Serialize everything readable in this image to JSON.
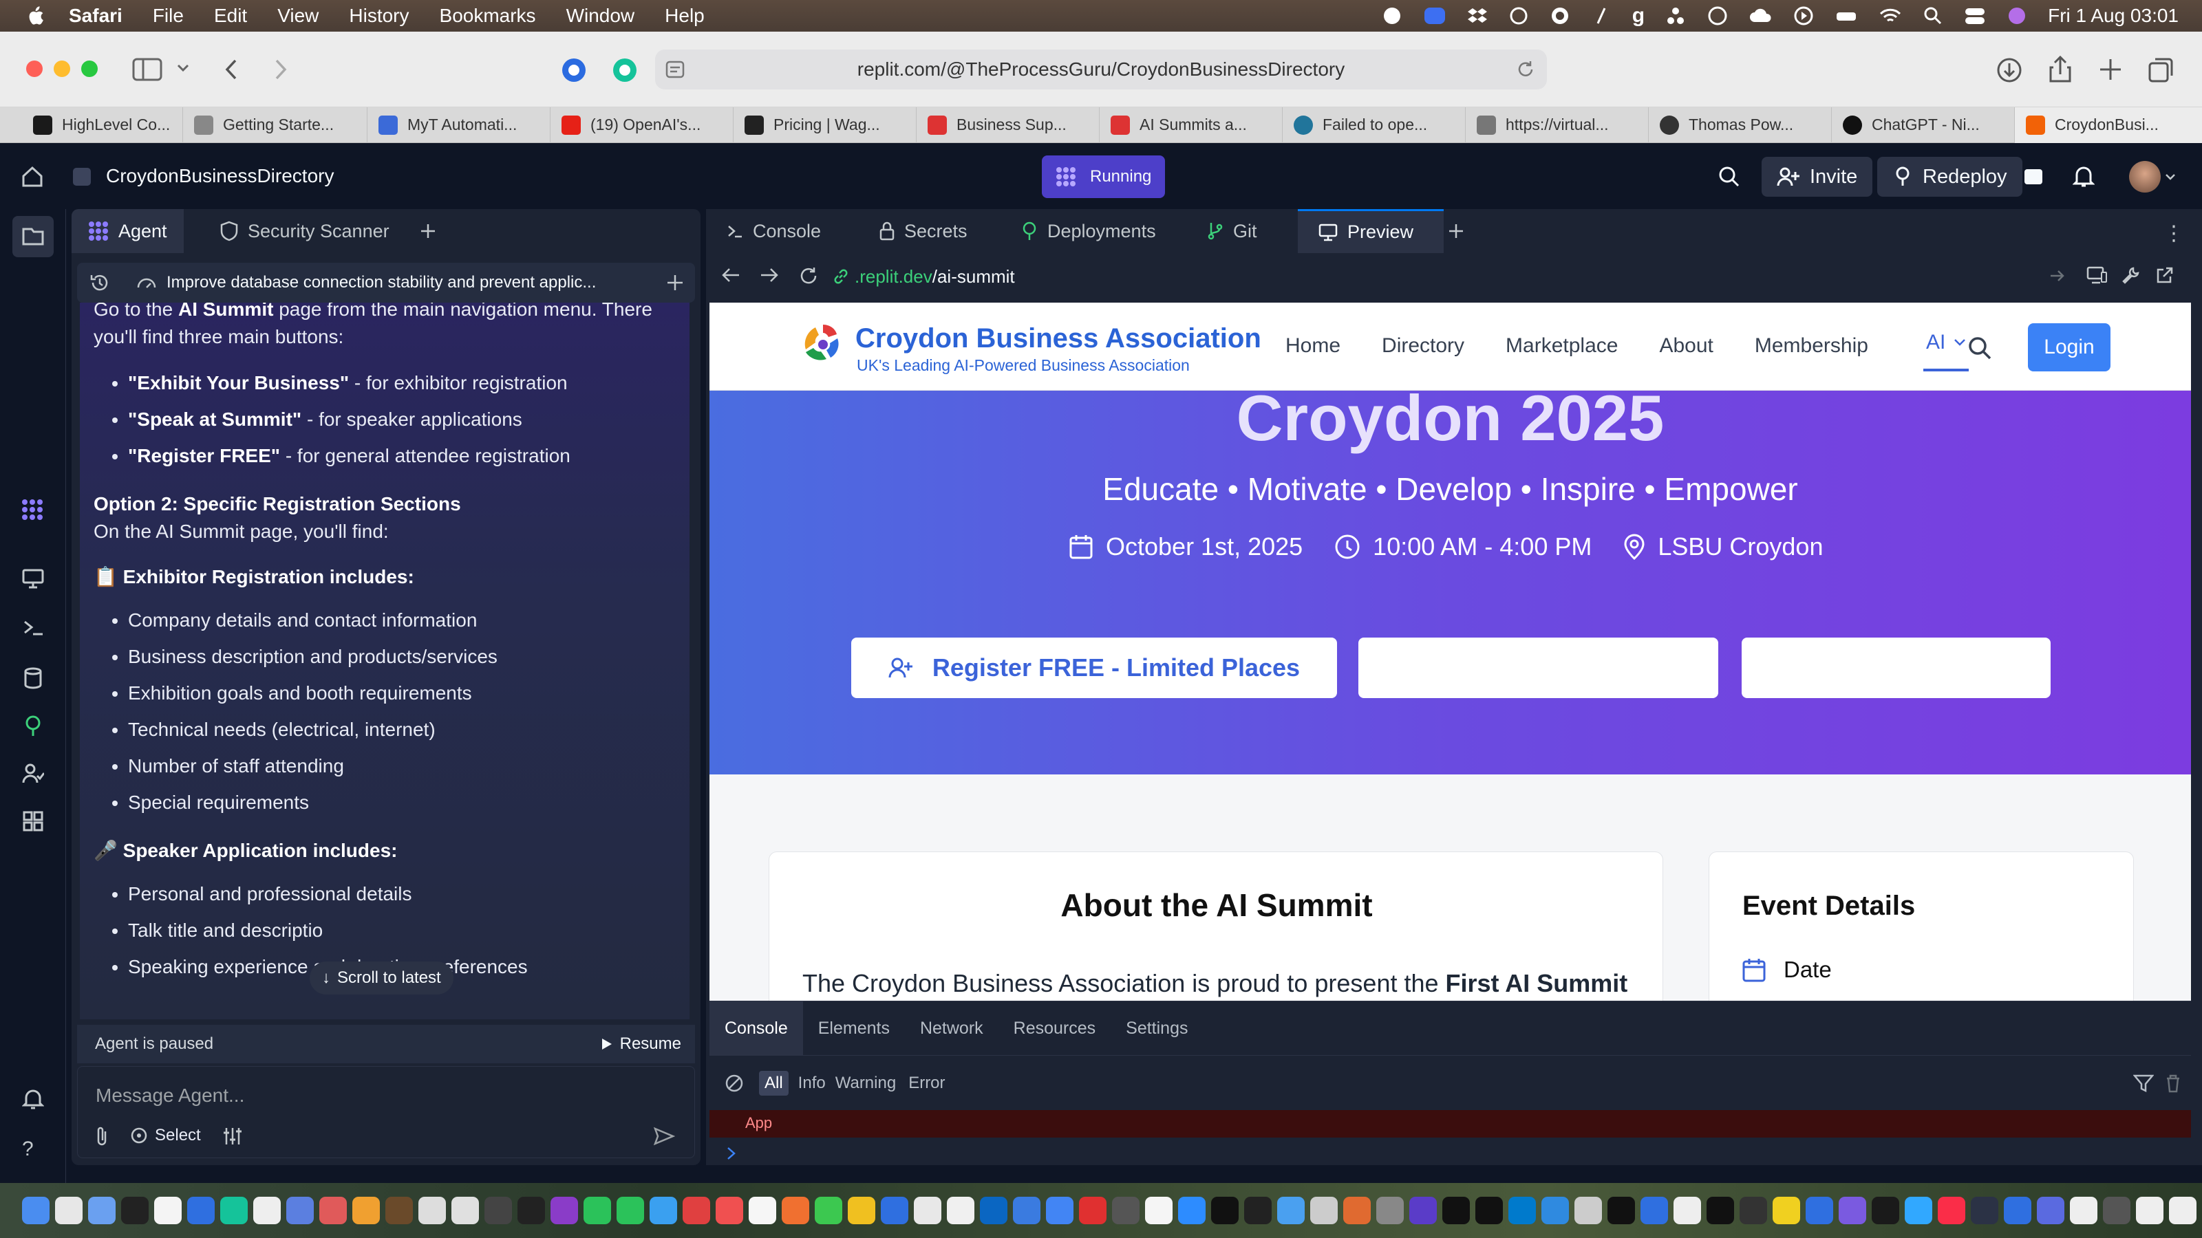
{
  "menubar": {
    "app": "Safari",
    "items": [
      "File",
      "Edit",
      "View",
      "History",
      "Bookmarks",
      "Window",
      "Help"
    ],
    "clock": "Fri 1 Aug  03:01"
  },
  "browser": {
    "url": "replit.com/@TheProcessGuru/CroydonBusinessDirectory",
    "tabs": [
      "HighLevel Co...",
      "Getting Starte...",
      "MyT Automati...",
      "(19) OpenAI's...",
      "Pricing | Wag...",
      "Business Sup...",
      "AI Summits a...",
      "Failed to ope...",
      "https://virtual...",
      "Thomas Pow...",
      "ChatGPT - Ni...",
      "CroydonBusi..."
    ]
  },
  "replit": {
    "project": "CroydonBusinessDirectory",
    "status": "Running",
    "invite": "Invite",
    "redeploy": "Redeploy",
    "left_tabs": {
      "agent": "Agent",
      "security": "Security Scanner"
    },
    "thread_title": "Improve database connection stability and prevent applic...",
    "right_tabs": {
      "console": "Console",
      "secrets": "Secrets",
      "deployments": "Deployments",
      "git": "Git",
      "preview": "Preview"
    },
    "preview_url_host": ".replit.dev",
    "preview_url_path": "/ai-summit"
  },
  "chat": {
    "intro_pre": "Go to the ",
    "intro_bold": "AI Summit",
    "intro_post": " page from the main navigation menu. There you'll find three main buttons:",
    "buttons": [
      {
        "b": "\"Exhibit Your Business\"",
        "t": " - for exhibitor registration"
      },
      {
        "b": "\"Speak at Summit\"",
        "t": " - for speaker applications"
      },
      {
        "b": "\"Register FREE\"",
        "t": " - for general attendee registration"
      }
    ],
    "opt2_title": "Option 2: Specific Registration Sections",
    "opt2_text": "On the AI Summit page, you'll find:",
    "exhib_title": "📋 Exhibitor Registration includes:",
    "exhib_items": [
      "Company details and contact information",
      "Business description and products/services",
      "Exhibition goals and booth requirements",
      "Technical needs (electrical, internet)",
      "Number of staff attending",
      "Special requirements"
    ],
    "speaker_title": "🎤 Speaker Application includes:",
    "speaker_items": [
      "Personal and professional details",
      "Talk title and descriptio"
    ],
    "speaker_cut": "Speaking experience and duration preferences",
    "scroll_latest": "Scroll to latest",
    "paused": "Agent is paused",
    "resume": "Resume",
    "placeholder": "Message Agent...",
    "select": "Select"
  },
  "site": {
    "brand": "Croydon Business Association",
    "tagline": "UK's Leading AI-Powered Business Association",
    "nav": [
      "Home",
      "Directory",
      "Marketplace",
      "About",
      "Membership"
    ],
    "nav_active": "AI",
    "login": "Login",
    "hero_title": "Croydon 2025",
    "hero_sub": "Educate • Motivate • Develop • Inspire • Empower",
    "date": "October 1st, 2025",
    "time": "10:00 AM - 4:00 PM",
    "venue": "LSBU Croydon",
    "cta": "Register FREE - Limited Places",
    "about_title": "About the AI Summit",
    "about_text_pre": "The Croydon Business Association is proud to present the ",
    "about_text_bold": "First AI Summit",
    "details_title": "Event Details",
    "details_date": "Date"
  },
  "devtools": {
    "tabs": [
      "Console",
      "Elements",
      "Network",
      "Resources",
      "Settings"
    ],
    "filters": [
      "All",
      "Info",
      "Warning",
      "Error"
    ],
    "log": "App"
  }
}
